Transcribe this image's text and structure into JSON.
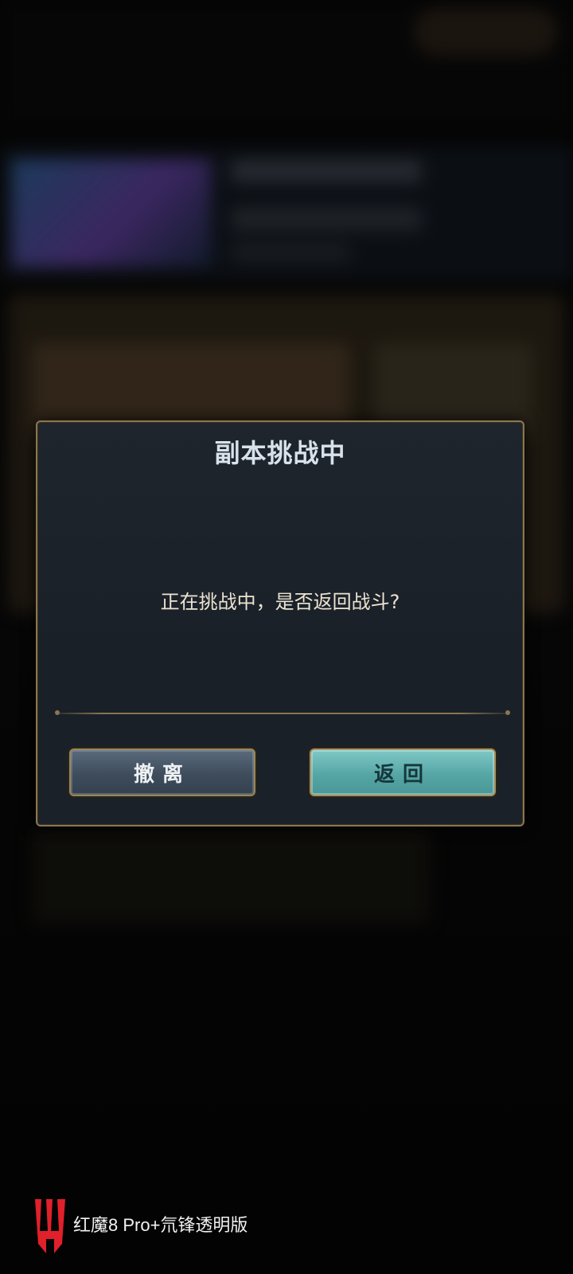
{
  "dialog": {
    "title": "副本挑战中",
    "message": "正在挑战中，是否返回战斗?",
    "withdraw_label": "撤离",
    "return_label": "返回"
  },
  "watermark": {
    "text": "红魔8 Pro+氘锋透明版",
    "logo_icon": "red-magic-logo-icon"
  },
  "colors": {
    "dialog_border": "#8a7650",
    "title": "#d8e2ea",
    "withdraw_button": "#46566a",
    "return_button": "#5fb0ae",
    "logo": "#e0202a"
  }
}
